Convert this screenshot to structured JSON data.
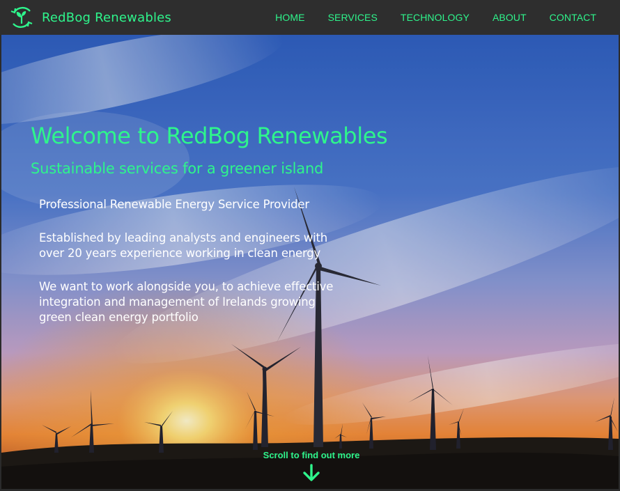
{
  "brand": {
    "name": "RedBog Renewables",
    "logo_icon": "leaf-recycle-icon",
    "accent_color": "#2ef58c"
  },
  "nav": {
    "links": [
      "HOME",
      "SERVICES",
      "TECHNOLOGY",
      "ABOUT",
      "CONTACT"
    ]
  },
  "hero": {
    "background": "wind-turbines-sunset-image",
    "title": "Welcome to RedBog Renewables",
    "subtitle": "Sustainable services for a greener island",
    "paragraphs": [
      "Professional Renewable Energy Service Provider",
      "Established by leading analysts and engineers with over 20 years experience working in clean energy",
      "We want to work alongside you, to achieve effective integration and management of Irelands growing green clean energy portfolio"
    ],
    "scroll_cue": "Scroll to find out more",
    "scroll_icon": "arrow-down-icon"
  }
}
